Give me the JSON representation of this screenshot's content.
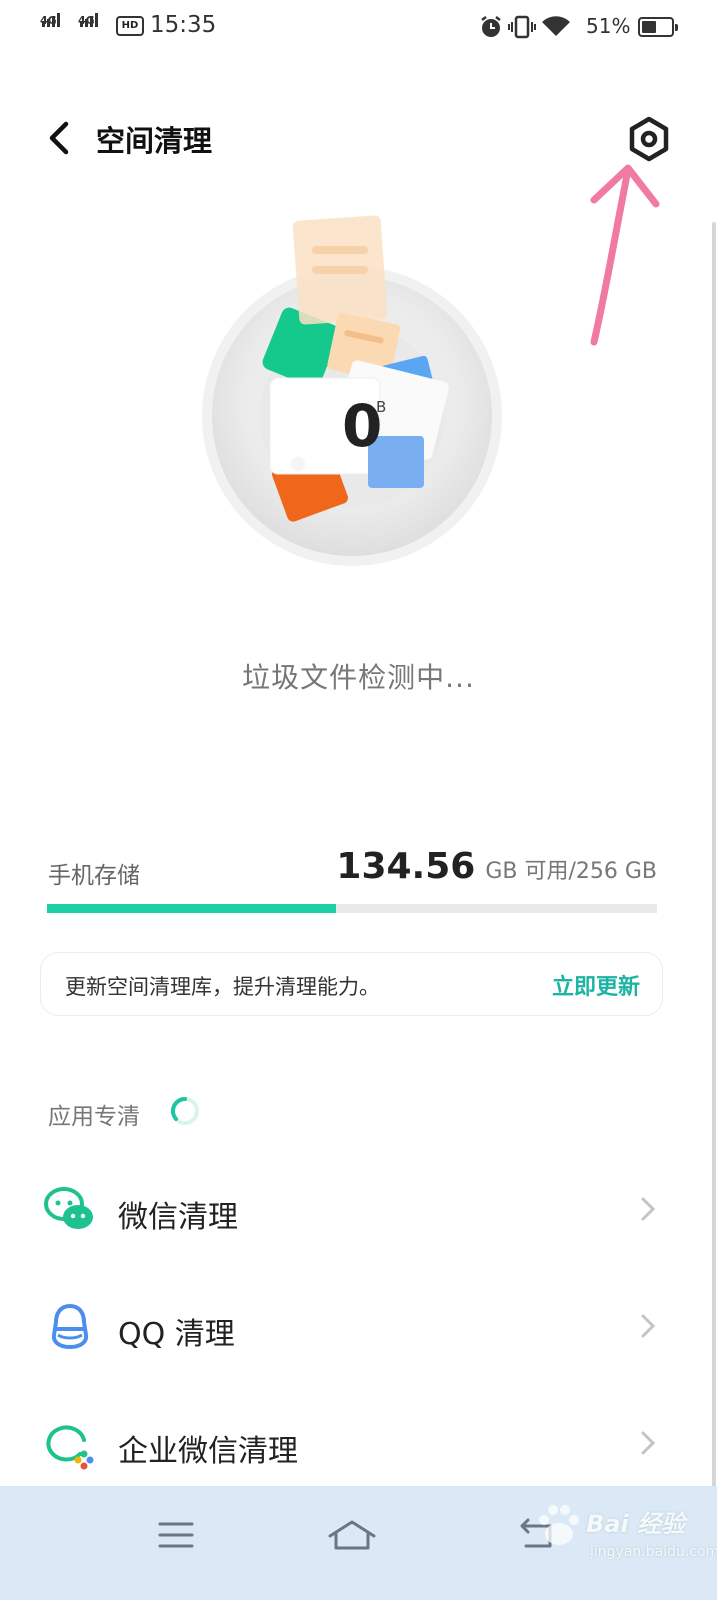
{
  "status_bar": {
    "sim1": "4G",
    "sim2": "4G",
    "hd": "HD",
    "time": "15:35",
    "icons": [
      "alarm-icon",
      "vibrate-icon",
      "wifi-icon"
    ],
    "battery_text": "51%",
    "battery_level": 0.51
  },
  "header": {
    "title": "空间清理",
    "back_icon": "back-arrow-icon",
    "settings_icon": "settings-gear-icon"
  },
  "scan": {
    "size_value": "0",
    "size_unit": "B",
    "status": "垃圾文件检测中..."
  },
  "storage": {
    "label": "手机存储",
    "available": "134.56",
    "detail": "GB 可用/256 GB",
    "used_fraction": 0.474
  },
  "update_card": {
    "text": "更新空间清理库，提升清理能力。",
    "action": "立即更新"
  },
  "app_clean": {
    "title": "应用专清",
    "items": [
      {
        "label": "微信清理",
        "icon": "wechat-icon"
      },
      {
        "label": "QQ 清理",
        "icon": "qq-icon"
      },
      {
        "label": "企业微信清理",
        "icon": "wecom-icon"
      }
    ]
  },
  "nav_bar": {
    "buttons": [
      "menu-icon",
      "home-icon",
      "back-icon"
    ]
  },
  "watermark": {
    "text": "Bai 经验",
    "sub": "jingyan.baidu.com"
  },
  "colors": {
    "accent": "#1ccfa4",
    "link": "#1cb4a2",
    "wechat": "#1fc28e",
    "qq": "#4a8ef0",
    "annotation": "#f07aa0",
    "navbar": "#dbe8f6"
  }
}
